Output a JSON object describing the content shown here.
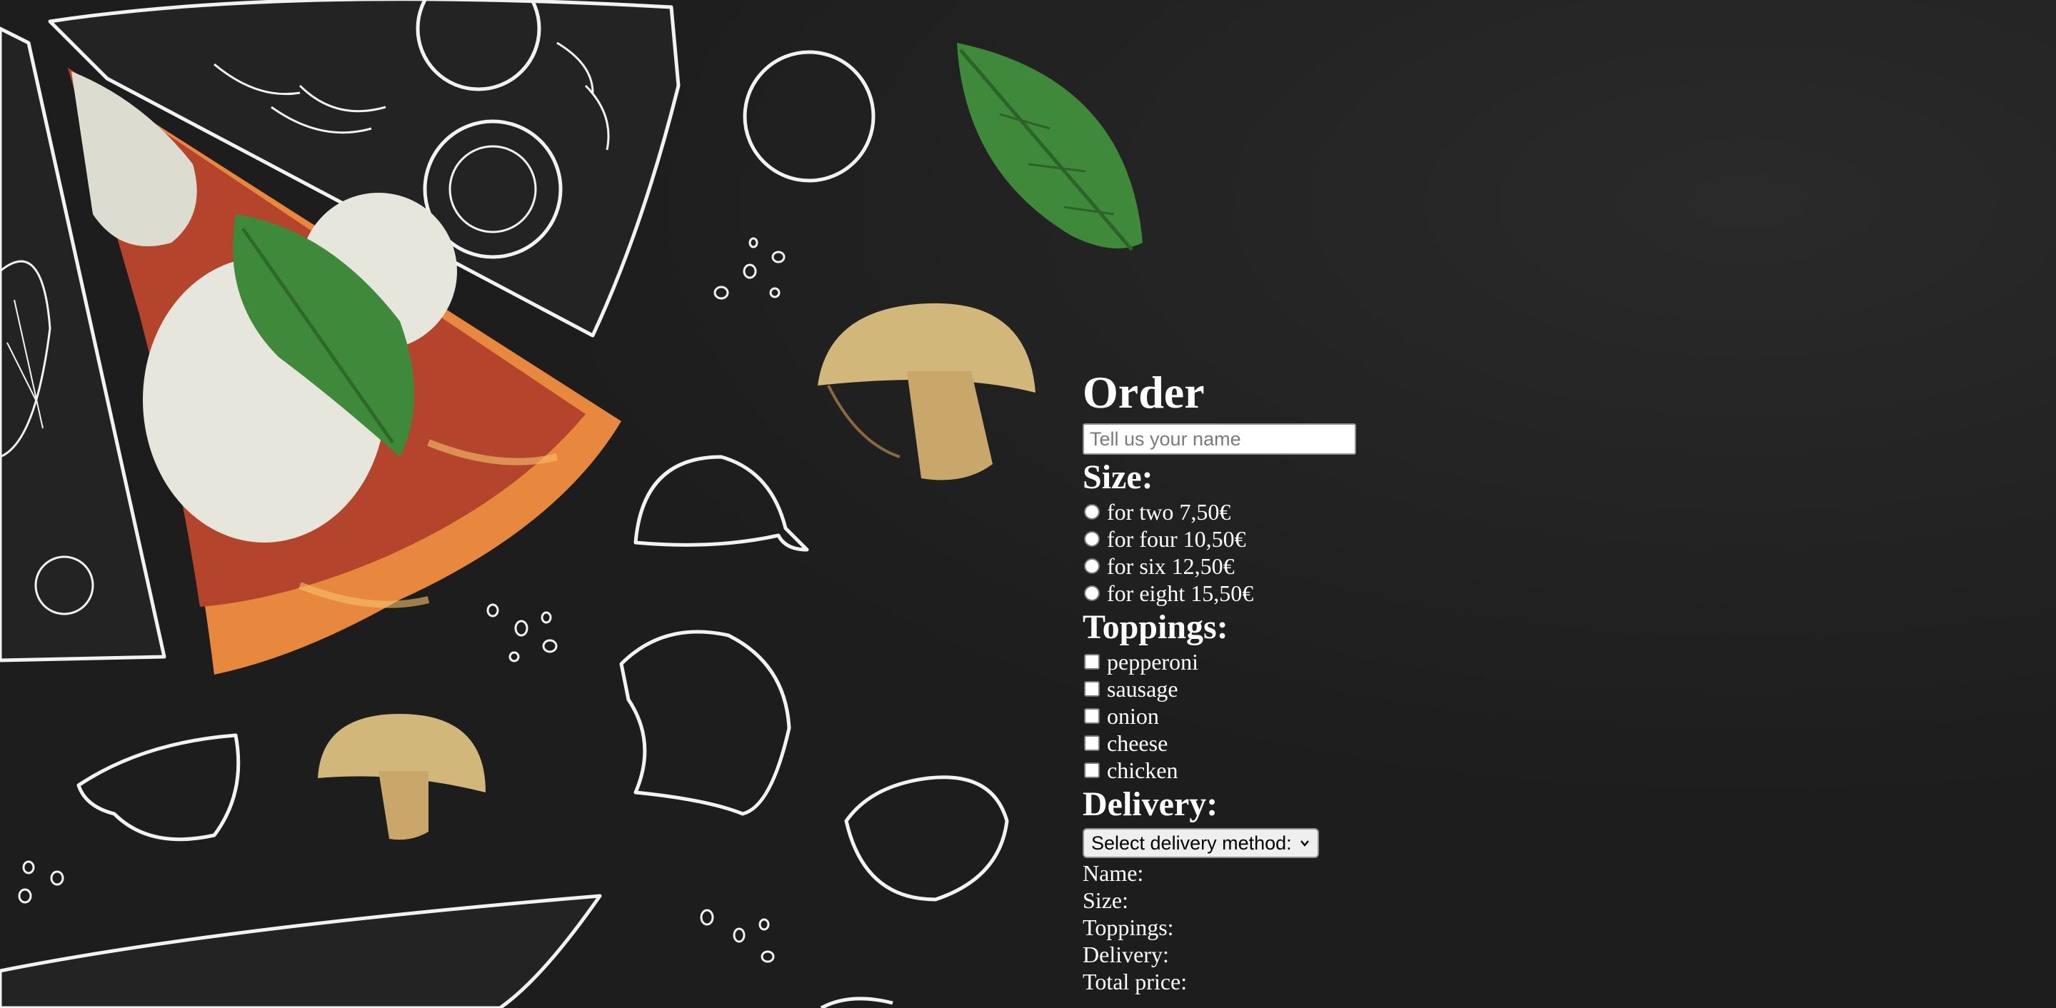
{
  "order": {
    "title": "Order",
    "name_placeholder": "Tell us your name",
    "size_heading": "Size:",
    "sizes": [
      {
        "label": "for two 7,50€"
      },
      {
        "label": "for four 10,50€"
      },
      {
        "label": "for six 12,50€"
      },
      {
        "label": "for eight 15,50€"
      }
    ],
    "toppings_heading": "Toppings:",
    "toppings": [
      {
        "label": "pepperoni"
      },
      {
        "label": "sausage"
      },
      {
        "label": "onion"
      },
      {
        "label": "cheese"
      },
      {
        "label": "chicken"
      }
    ],
    "delivery_heading": "Delivery:",
    "delivery_select": "Select delivery method:",
    "summary": {
      "name": "Name:",
      "size": "Size:",
      "toppings": "Toppings:",
      "delivery": "Delivery:",
      "total": "Total price:"
    }
  },
  "colors": {
    "background": "#1e1e1e",
    "text": "#ffffff",
    "basil": "#3f8a3a",
    "mushroom": "#d2b77a",
    "crust": "#e8873e",
    "sauce": "#b5442c"
  }
}
